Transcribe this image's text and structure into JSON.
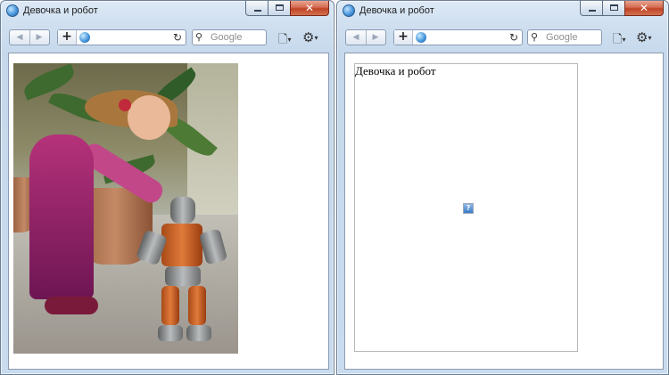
{
  "windows": [
    {
      "title": "Девочка и робот",
      "toolbar": {
        "back_label": "◀",
        "forward_label": "▶",
        "new_tab_label": "+",
        "refresh_label": "↻",
        "search_placeholder": "Google",
        "search_icon": "⚲",
        "page_label": "🗋",
        "tools_label": "⚙",
        "dropdown": "▾"
      },
      "content": {
        "type": "image",
        "description_icon": "photo"
      }
    },
    {
      "title": "Девочка и робот",
      "toolbar": {
        "back_label": "◀",
        "forward_label": "▶",
        "new_tab_label": "+",
        "refresh_label": "↻",
        "search_placeholder": "Google",
        "search_icon": "⚲",
        "page_label": "🗋",
        "tools_label": "⚙",
        "dropdown": "▾"
      },
      "content": {
        "type": "broken-image",
        "alt_text": "Девочка и робот",
        "broken_icon_glyph": "?"
      }
    }
  ],
  "window_controls": {
    "minimize": "",
    "maximize": "",
    "close": "✕"
  },
  "colors": {
    "titlebar": "#cfdff0",
    "close": "#c04427",
    "frame_border": "#6f7f93"
  }
}
